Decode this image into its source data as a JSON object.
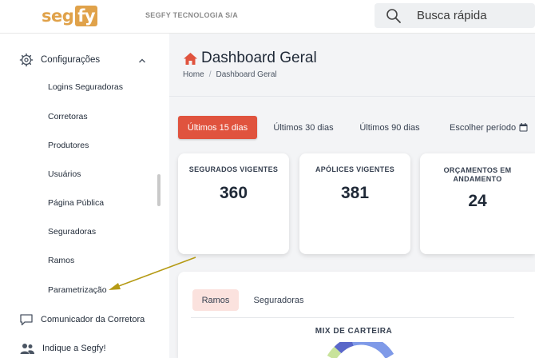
{
  "header": {
    "logo_a": "seg",
    "logo_b": "fy",
    "company": "SEGFY TECNOLOGIA S/A",
    "search_placeholder": "Busca rápida"
  },
  "sidebar": {
    "section": "Configurações",
    "items": [
      "Logins Seguradoras",
      "Corretoras",
      "Produtores",
      "Usuários",
      "Página Pública",
      "Seguradoras",
      "Ramos",
      "Parametrização"
    ],
    "communicator": "Comunicador da Corretora",
    "refer": "Indique a Segfy!"
  },
  "main": {
    "title": "Dashboard Geral",
    "breadcrumb": [
      "Home",
      "Dashboard Geral"
    ],
    "periods": [
      "Últimos 15 dias",
      "Últimos 30 dias",
      "Últimos 90 dias",
      "Escolher período"
    ],
    "cards": [
      {
        "label": "SEGURADOS VIGENTES",
        "value": "360"
      },
      {
        "label": "APÓLICES VIGENTES",
        "value": "381"
      },
      {
        "label": "ORÇAMENTOS EM ANDAMENTO",
        "value": "24"
      }
    ],
    "tabs": [
      "Ramos",
      "Seguradoras"
    ],
    "mix_title": "MIX DE CARTEIRA"
  },
  "colors": {
    "accent": "#e0533e",
    "logo": "#e0a24a",
    "arrow": "#b59a14"
  }
}
